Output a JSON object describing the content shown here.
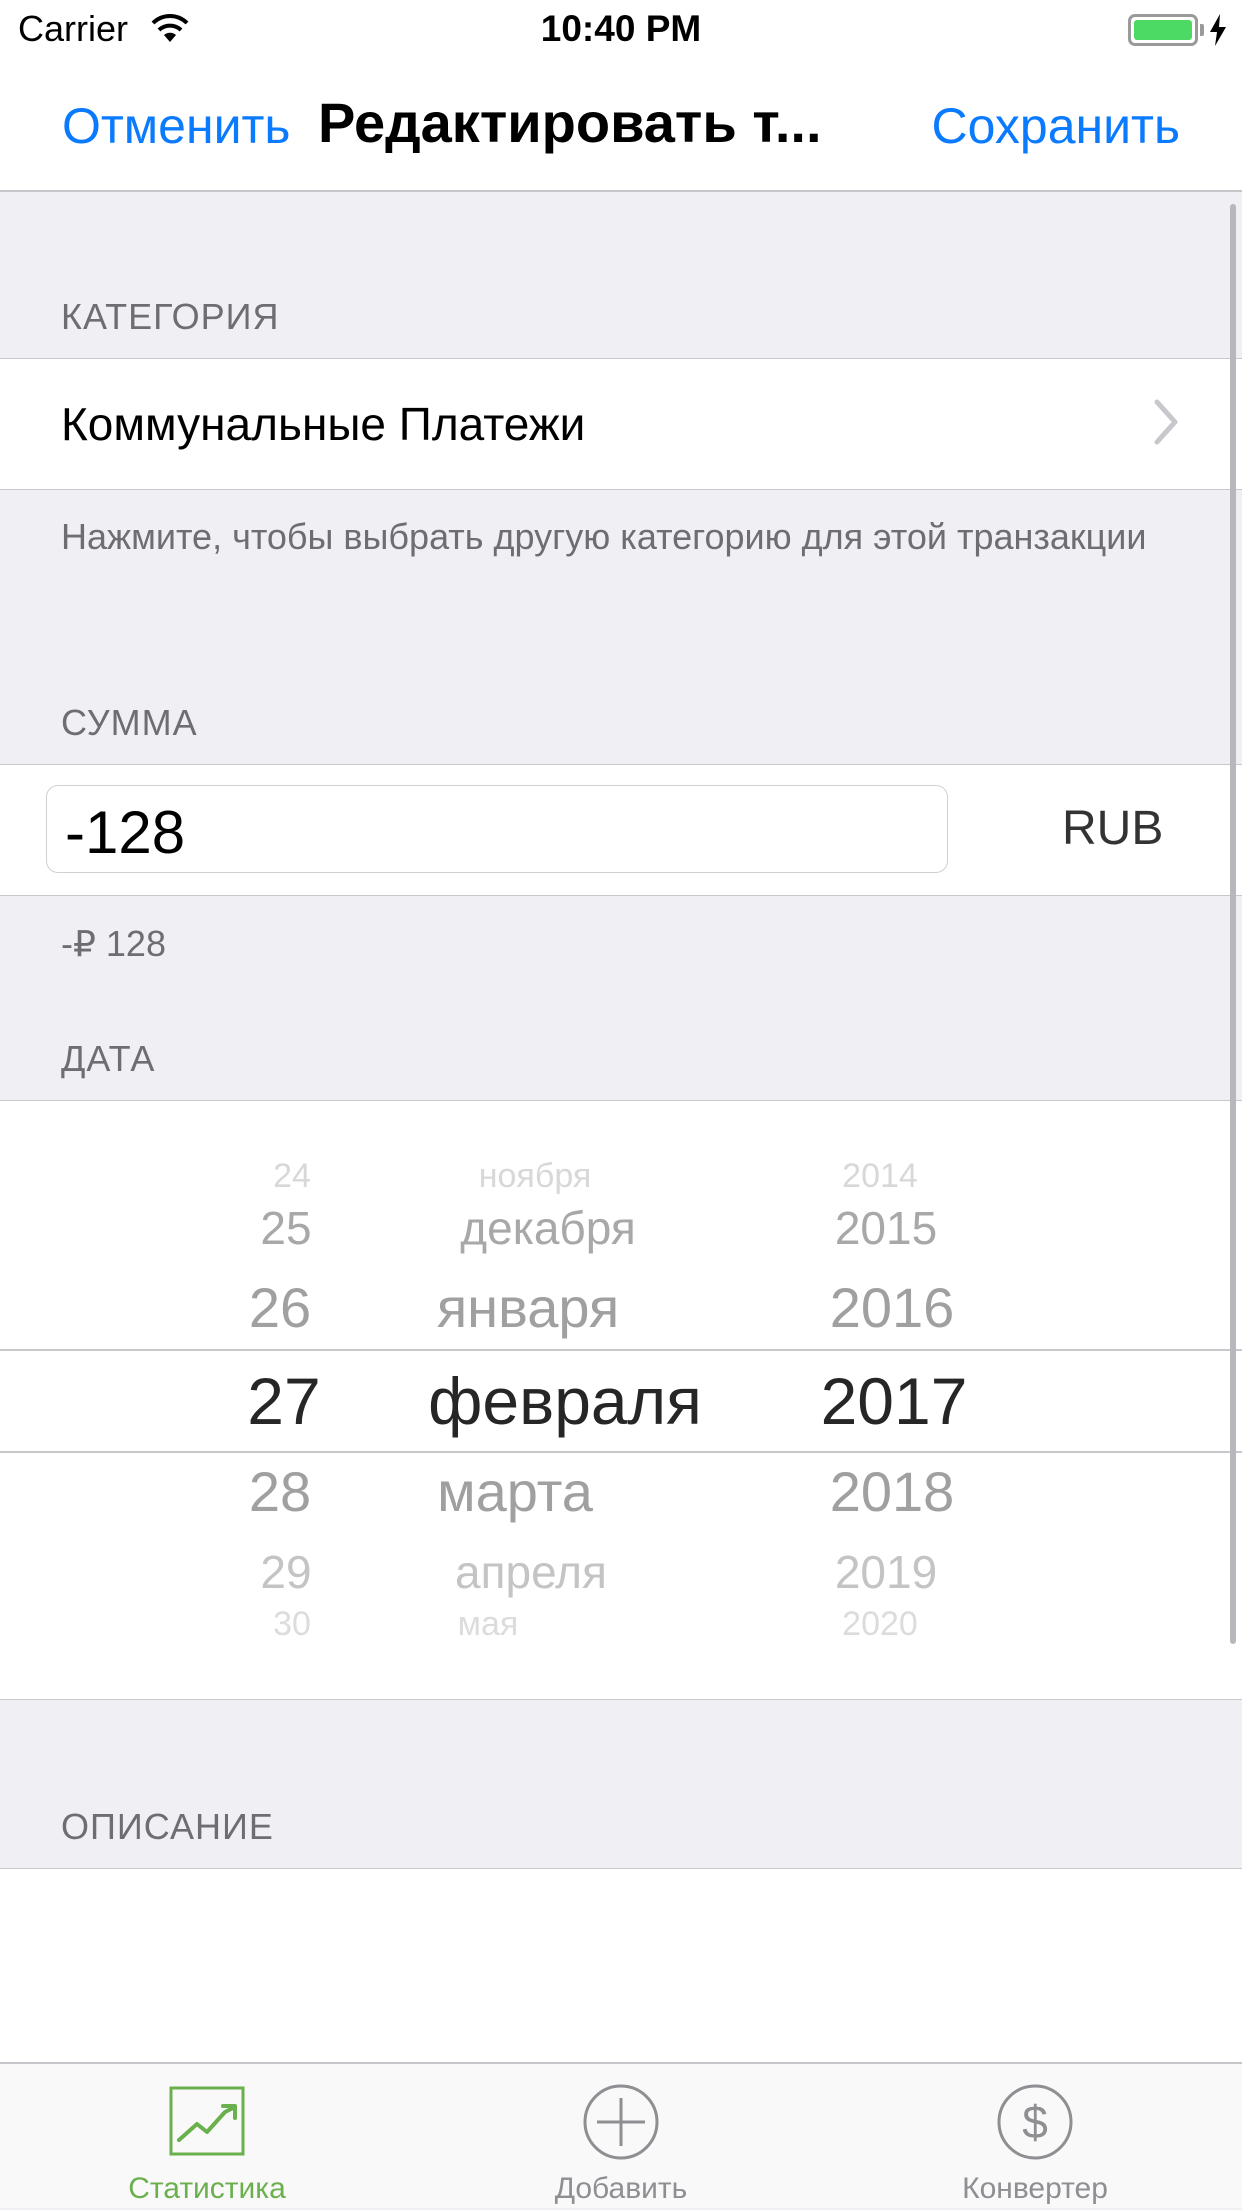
{
  "status_bar": {
    "carrier": "Carrier",
    "time": "10:40 PM"
  },
  "nav": {
    "cancel_label": "Отменить",
    "title": "Редактировать т...",
    "save_label": "Сохранить"
  },
  "category": {
    "header": "КАТЕГОРИЯ",
    "value": "Коммунальные Платежи",
    "footer": "Нажмите, чтобы выбрать другую категорию для этой транзакции"
  },
  "amount": {
    "header": "СУММА",
    "value": "-128",
    "currency": "RUB",
    "formatted": "-₽ 128"
  },
  "date": {
    "header": "ДАТА",
    "days": [
      "24",
      "25",
      "26",
      "27",
      "28",
      "29",
      "30"
    ],
    "months": [
      "ноября",
      "декабря",
      "января",
      "февраля",
      "марта",
      "апреля",
      "мая"
    ],
    "years": [
      "2014",
      "2015",
      "2016",
      "2017",
      "2018",
      "2019",
      "2020"
    ],
    "selected": {
      "day": "27",
      "month": "февраля",
      "year": "2017"
    }
  },
  "description": {
    "header": "ОПИСАНИЕ"
  },
  "tab_bar": {
    "tabs": [
      {
        "label": "Статистика",
        "icon": "chart-icon",
        "active": true
      },
      {
        "label": "Добавить",
        "icon": "plus-circle-icon",
        "active": false
      },
      {
        "label": "Конвертер",
        "icon": "dollar-circle-icon",
        "active": false
      }
    ]
  },
  "colors": {
    "accent": "#0a7aff",
    "active_tab": "#6ab04c",
    "battery": "#4cd964"
  }
}
